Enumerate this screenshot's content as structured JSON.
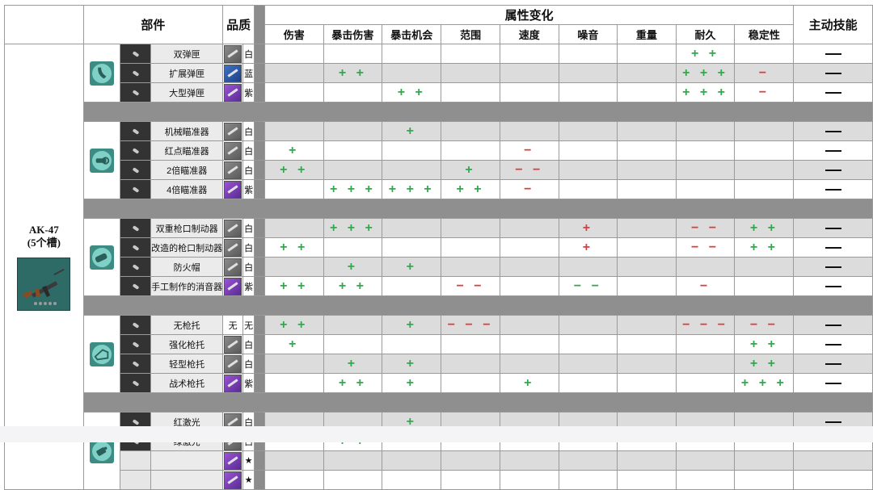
{
  "header": {
    "part": "部件",
    "quality": "品质",
    "attributes": "属性变化",
    "skill": "主动技能",
    "columns": [
      "伤害",
      "暴击伤害",
      "暴击机会",
      "范围",
      "速度",
      "噪音",
      "重量",
      "耐久",
      "稳定性"
    ]
  },
  "gun": {
    "name": "AK-47",
    "slots": "(5个槽)"
  },
  "skill_dash": "—",
  "groups": [
    {
      "category_icon": "magazine-icon",
      "rows": [
        {
          "name": "双弹匣",
          "q": "白",
          "qc": "white",
          "a": [
            "",
            "",
            "",
            "",
            "",
            "",
            "",
            "+ +",
            ""
          ]
        },
        {
          "name": "扩展弹匣",
          "q": "蓝",
          "qc": "blue",
          "a": [
            "",
            "+ +",
            "",
            "",
            "",
            "",
            "",
            "+ + +",
            "−"
          ]
        },
        {
          "name": "大型弹匣",
          "q": "紫",
          "qc": "purple",
          "a": [
            "",
            "",
            "+ +",
            "",
            "",
            "",
            "",
            "+ + +",
            "−"
          ]
        }
      ]
    },
    {
      "category_icon": "scope-icon",
      "rows": [
        {
          "name": "机械瞄准器",
          "q": "白",
          "qc": "white",
          "a": [
            "",
            "",
            "+",
            "",
            "",
            "",
            "",
            "",
            ""
          ]
        },
        {
          "name": "红点瞄准器",
          "q": "白",
          "qc": "white",
          "a": [
            "+",
            "",
            "",
            "",
            "−",
            "",
            "",
            "",
            ""
          ]
        },
        {
          "name": "2倍瞄准器",
          "q": "白",
          "qc": "white",
          "a": [
            "+ +",
            "",
            "",
            "+",
            "− −",
            "",
            "",
            "",
            ""
          ]
        },
        {
          "name": "4倍瞄准器",
          "q": "紫",
          "qc": "purple",
          "a": [
            "",
            "+ + +",
            "+ + +",
            "+ +",
            "−",
            "",
            "",
            "",
            ""
          ]
        }
      ]
    },
    {
      "category_icon": "muzzle-icon",
      "rows": [
        {
          "name": "双重枪口制动器",
          "q": "白",
          "qc": "white",
          "a": [
            "",
            "+ + +",
            "",
            "",
            "",
            "+",
            "",
            "− −",
            "+ +"
          ]
        },
        {
          "name": "改造的枪口制动器",
          "q": "白",
          "qc": "white",
          "a": [
            "+ +",
            "",
            "",
            "",
            "",
            "+",
            "",
            "− −",
            "+ +"
          ]
        },
        {
          "name": "防火帽",
          "q": "白",
          "qc": "white",
          "a": [
            "",
            "+",
            "+",
            "",
            "",
            "",
            "",
            "",
            ""
          ]
        },
        {
          "name": "手工制作的消音器",
          "q": "紫",
          "qc": "purple",
          "a": [
            "+ +",
            "+ +",
            "",
            "− −",
            "",
            "− −",
            "",
            "−",
            ""
          ]
        }
      ]
    },
    {
      "category_icon": "stock-icon",
      "rows": [
        {
          "name": "无枪托",
          "q": "无",
          "qc": "none",
          "a": [
            "+ +",
            "",
            "+",
            "− − −",
            "",
            "",
            "",
            "− − −",
            "− −"
          ]
        },
        {
          "name": "强化枪托",
          "q": "白",
          "qc": "white",
          "a": [
            "+",
            "",
            "",
            "",
            "",
            "",
            "",
            "",
            "+ +"
          ]
        },
        {
          "name": "轻型枪托",
          "q": "白",
          "qc": "white",
          "a": [
            "",
            "+",
            "+",
            "",
            "",
            "",
            "",
            "",
            "+ +"
          ]
        },
        {
          "name": "战术枪托",
          "q": "紫",
          "qc": "purple",
          "a": [
            "",
            "+ +",
            "+",
            "",
            "+",
            "",
            "",
            "",
            "+ + +"
          ]
        }
      ]
    },
    {
      "category_icon": "laser-icon",
      "rows": [
        {
          "name": "红激光",
          "q": "白",
          "qc": "white",
          "a": [
            "",
            "",
            "+",
            "",
            "",
            "",
            "",
            "",
            ""
          ]
        },
        {
          "name": "绿激光",
          "q": "白",
          "qc": "white",
          "a": [
            "",
            "+ +",
            "",
            "",
            "",
            "",
            "",
            "",
            ""
          ]
        },
        {
          "name": "",
          "q": "★",
          "qc": "purple",
          "a": [
            "",
            "",
            "",
            "",
            "",
            "",
            "",
            "",
            ""
          ],
          "noskill": true
        },
        {
          "name": "",
          "q": "★",
          "qc": "purple",
          "a": [
            "",
            "",
            "",
            "",
            "",
            "",
            "",
            "",
            ""
          ],
          "noskill": true
        }
      ]
    }
  ],
  "colors": {
    "plus": "#2eaa4b",
    "minus": "#e23a3a",
    "row_alt": "#dcdcdc",
    "separator": "#8c8c8c"
  }
}
